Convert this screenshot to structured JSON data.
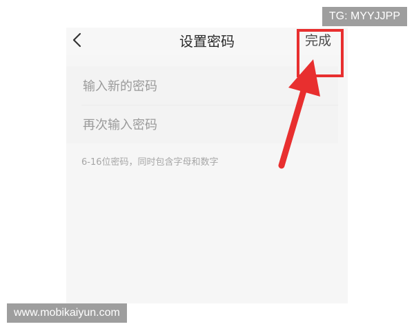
{
  "nav": {
    "title": "设置密码",
    "done_label": "完成",
    "back_icon": "chevron-left-icon"
  },
  "form": {
    "new_password_placeholder": "输入新的密码",
    "new_password_value": "",
    "confirm_password_placeholder": "再次输入密码",
    "confirm_password_value": ""
  },
  "hint": "6-16位密码，同时包含字母和数字",
  "annotation": {
    "highlight_color": "#e82f2f"
  },
  "watermarks": {
    "top_right": "TG: MYYJJPP",
    "bottom_left": "www.mobikaiyun.com"
  }
}
